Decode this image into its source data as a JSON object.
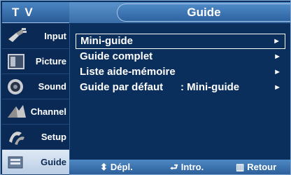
{
  "header": {
    "left_title": "TV",
    "title": "Guide"
  },
  "sidebar": {
    "items": [
      {
        "label": "Input",
        "icon": "input-plug-icon"
      },
      {
        "label": "Picture",
        "icon": "picture-icon"
      },
      {
        "label": "Sound",
        "icon": "speaker-icon"
      },
      {
        "label": "Channel",
        "icon": "channel-icon"
      },
      {
        "label": "Setup",
        "icon": "setup-icon"
      },
      {
        "label": "Guide",
        "icon": "guide-icon",
        "active": true
      }
    ]
  },
  "menu": {
    "items": [
      {
        "label": "Mini-guide",
        "arrow": "►",
        "selected": true
      },
      {
        "label": "Guide complet",
        "arrow": "►"
      },
      {
        "label": "Liste aide-mémoire",
        "arrow": "►"
      },
      {
        "label": "Guide par défaut",
        "value": ": Mini-guide",
        "arrow": "►"
      }
    ]
  },
  "footer": {
    "move_label": "Dépl.",
    "enter_label": "Intro.",
    "return_label": "Retour"
  },
  "colors": {
    "background": "#0b2f5c",
    "header": "#4a86c2",
    "text": "#ffffff"
  }
}
